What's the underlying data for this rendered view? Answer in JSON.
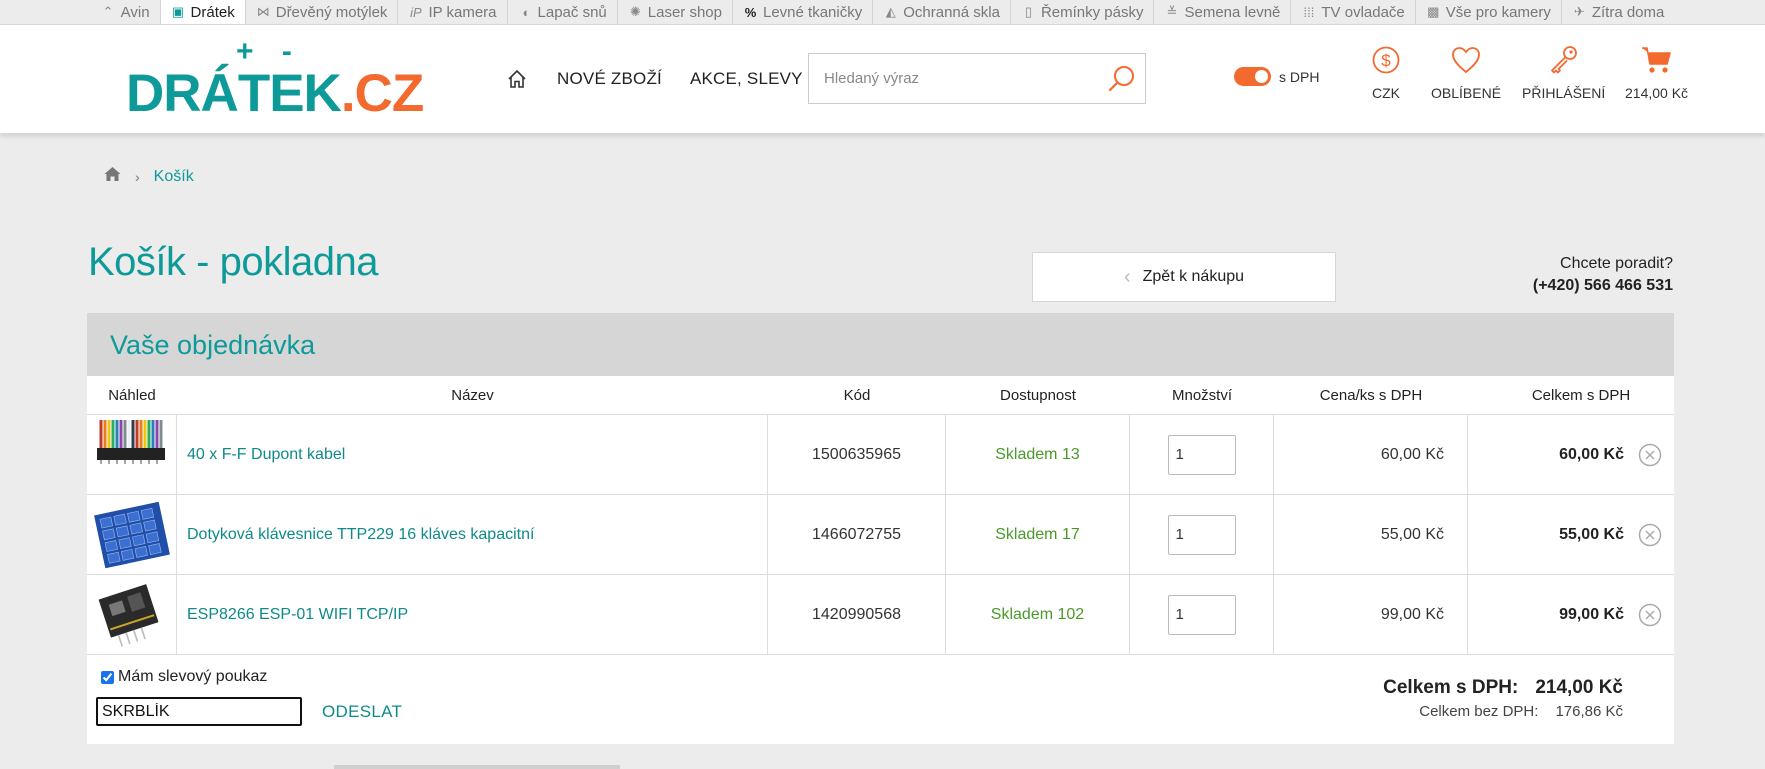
{
  "topbar": {
    "tabs": [
      {
        "label": "Avin",
        "icon": "avin-logo-icon"
      },
      {
        "label": "Drátek",
        "icon": "dratek-logo-icon",
        "active": true
      },
      {
        "label": "Dřevěný motýlek",
        "icon": "bowtie-icon"
      },
      {
        "label": "IP kamera",
        "icon": "ip-camera-icon"
      },
      {
        "label": "Lapač snů",
        "icon": "dreamcatcher-icon"
      },
      {
        "label": "Laser shop",
        "icon": "laser-icon"
      },
      {
        "label": "Levné tkaničky",
        "icon": "percent-icon"
      },
      {
        "label": "Ochranná skla",
        "icon": "glass-icon"
      },
      {
        "label": "Řemínky pásky",
        "icon": "watch-strap-icon"
      },
      {
        "label": "Semena levně",
        "icon": "seeds-icon"
      },
      {
        "label": "TV ovladače",
        "icon": "remote-grid-icon"
      },
      {
        "label": "Vše pro kamery",
        "icon": "camera-icon"
      },
      {
        "label": "Zítra doma",
        "icon": "delivery-icon"
      }
    ]
  },
  "header": {
    "logo": {
      "plusminus": "+ -",
      "part1": "DRÁTEK",
      "part2": ".CZ"
    },
    "nav": {
      "new_goods": "NOVÉ ZBOŽÍ",
      "sales": "AKCE, SLEVY"
    },
    "search": {
      "placeholder": "Hledaný výraz"
    },
    "vat_label": "s DPH",
    "currency_label": "CZK",
    "favorites_label": "OBLÍBENÉ",
    "login_label": "PŘIHLÁŠENÍ",
    "cart_label": "214,00 Kč",
    "accent_color": "#f26a2e",
    "brand_color": "#0f9a9a"
  },
  "breadcrumb": {
    "current": "Košík"
  },
  "page": {
    "title": "Košík - pokladna",
    "back_button": "Zpět k nákupu",
    "help_question": "Chcete poradit?",
    "help_phone": "(+420) 566 466 531"
  },
  "order": {
    "title": "Vaše objednávka",
    "columns": {
      "preview": "Náhled",
      "name": "Název",
      "code": "Kód",
      "availability": "Dostupnost",
      "quantity": "Množství",
      "unit_price": "Cena/ks s DPH",
      "total": "Celkem s DPH"
    },
    "items": [
      {
        "name": "40 x F-F Dupont kabel",
        "code": "1500635965",
        "availability": "Skladem 13",
        "qty": "1",
        "unit_price": "60,00 Kč",
        "total": "60,00 Kč",
        "thumb": "dupont-cable-image"
      },
      {
        "name": "Dotyková klávesnice TTP229 16 kláves kapacitní",
        "code": "1466072755",
        "availability": "Skladem 17",
        "qty": "1",
        "unit_price": "55,00 Kč",
        "total": "55,00 Kč",
        "thumb": "keypad-image"
      },
      {
        "name": "ESP8266 ESP-01 WIFI TCP/IP",
        "code": "1420990568",
        "availability": "Skladem 102",
        "qty": "1",
        "unit_price": "99,00 Kč",
        "total": "99,00 Kč",
        "thumb": "esp-module-image"
      }
    ],
    "coupon": {
      "checkbox_label": "Mám slevový poukaz",
      "checked": true,
      "value": "SKRBLÍK",
      "send_label": "ODESLAT"
    },
    "totals": {
      "with_vat_label": "Celkem s DPH:",
      "with_vat_value": "214,00 Kč",
      "without_vat_label": "Celkem bez DPH:",
      "without_vat_value": "176,86 Kč"
    }
  }
}
